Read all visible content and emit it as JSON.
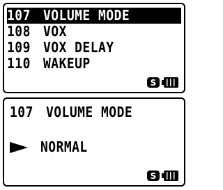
{
  "menu_screen": {
    "items": [
      {
        "number": "107",
        "label": "VOLUME MODE",
        "selected": true
      },
      {
        "number": "108",
        "label": "VOX",
        "selected": false
      },
      {
        "number": "109",
        "label": "VOX DELAY",
        "selected": false
      },
      {
        "number": "110",
        "label": "WAKEUP",
        "selected": false
      }
    ],
    "status": {
      "s_badge": "S",
      "battery_icon": "battery-icon"
    }
  },
  "setting_screen": {
    "number": "107",
    "title": "VOLUME MODE",
    "pointer_icon": "arrow-right-icon",
    "value": "NORMAL",
    "status": {
      "s_badge": "S",
      "battery_icon": "battery-icon"
    }
  }
}
